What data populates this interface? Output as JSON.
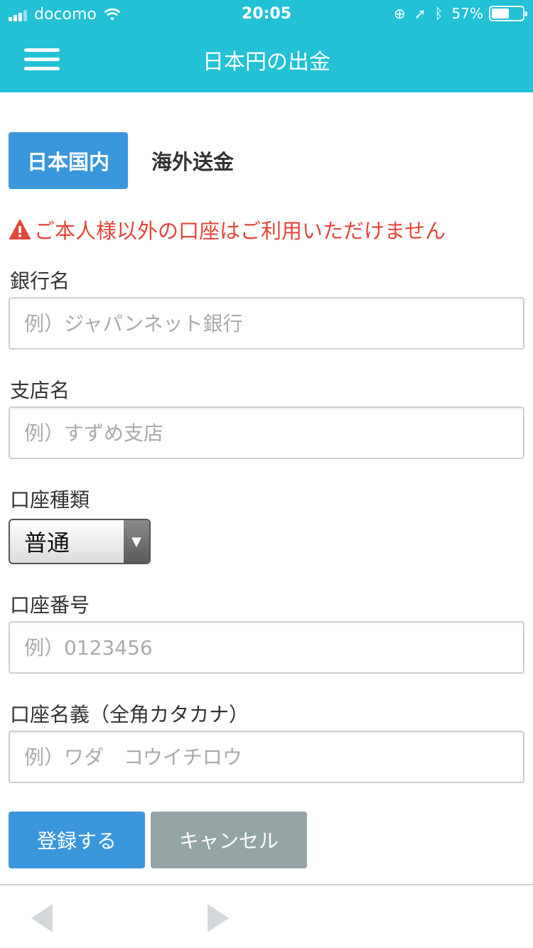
{
  "status_bar": {
    "carrier": "docomo",
    "time": "20:05",
    "battery": "57%",
    "battery_level": 0.57
  },
  "header": {
    "title": "日本円の出金",
    "menu_icon": "hamburger-menu-icon"
  },
  "tabs": [
    {
      "label": "日本国内",
      "active": true
    },
    {
      "label": "海外送金",
      "active": false
    }
  ],
  "warning": {
    "icon": "warning-triangle-icon",
    "text": "ご本人様以外の口座はご利用いただけません",
    "color": "#e3463a"
  },
  "form": {
    "bank_name": {
      "label": "銀行名",
      "placeholder": "例）ジャパンネット銀行"
    },
    "branch_name": {
      "label": "支店名",
      "placeholder": "例）すずめ支店"
    },
    "account_type": {
      "label": "口座種類",
      "value": "普通"
    },
    "account_number": {
      "label": "口座番号",
      "placeholder": "例）0123456"
    },
    "account_holder": {
      "label": "口座名義（全角カタカナ）",
      "placeholder": "例）ワダ　コウイチロウ"
    }
  },
  "buttons": {
    "register": "登録する",
    "cancel": "キャンセル"
  },
  "colors": {
    "header": "#22c1d6",
    "primary": "#3a97dc",
    "secondary": "#95a5a6"
  }
}
